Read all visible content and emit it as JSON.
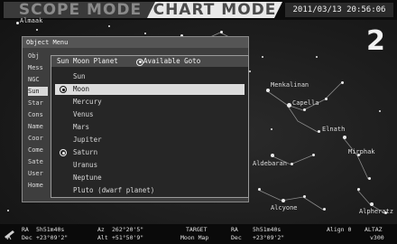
{
  "header": {
    "scope_mode": "SCOPE MODE",
    "chart_mode": "CHART MODE",
    "datetime": "2011/03/13 20:56:06"
  },
  "panel_number": "2",
  "sky_labels": [
    {
      "id": "almaak",
      "text": "Almaak"
    },
    {
      "id": "menkalinan",
      "text": "Menkalinan"
    },
    {
      "id": "capella",
      "text": "Capella"
    },
    {
      "id": "elnath",
      "text": "Elnath"
    },
    {
      "id": "aldebaran",
      "text": "Aldebaran"
    },
    {
      "id": "mirphak",
      "text": "Mirphak"
    },
    {
      "id": "alcyone",
      "text": "Alcyone"
    },
    {
      "id": "alpheratz",
      "text": "Alpheratz"
    }
  ],
  "object_menu": {
    "title": "Object Menu",
    "categories": [
      "Obj",
      "Mess",
      "NGC",
      "Sun",
      "Star",
      "Cons",
      "Name",
      "Coor",
      "Come",
      "Sate",
      "User",
      "Home"
    ],
    "selected_index": 3
  },
  "sub_menu": {
    "title": "Sun Moon Planet",
    "available": "Available Goto",
    "items": [
      {
        "label": "Sun",
        "radio": false
      },
      {
        "label": "Moon",
        "radio": true
      },
      {
        "label": "Mercury",
        "radio": false
      },
      {
        "label": "Venus",
        "radio": false
      },
      {
        "label": "Mars",
        "radio": false
      },
      {
        "label": "Jupiter",
        "radio": false
      },
      {
        "label": "Saturn",
        "radio": true
      },
      {
        "label": "Uranus",
        "radio": false
      },
      {
        "label": "Neptune",
        "radio": false
      },
      {
        "label": "Pluto (dwarf planet)",
        "radio": false
      }
    ],
    "selected_index": 1
  },
  "status": {
    "ra_label": "RA",
    "ra_value": "5h51m40s",
    "dec_label": "Dec",
    "dec_value": "+23°09'2\"",
    "az_label": "Az",
    "az_value": "262°20'5\"",
    "alt_label": "Alt",
    "alt_value": "+51°50'9\"",
    "target_label": "TARGET",
    "target_name": "Moon Map",
    "t_ra_label": "RA",
    "t_ra_value": "5h51m40s",
    "t_dec_label": "Dec",
    "t_dec_value": "+23°09'2\"",
    "align_label": "Align 0",
    "mode_label": "ALTAZ",
    "version": "v300"
  }
}
